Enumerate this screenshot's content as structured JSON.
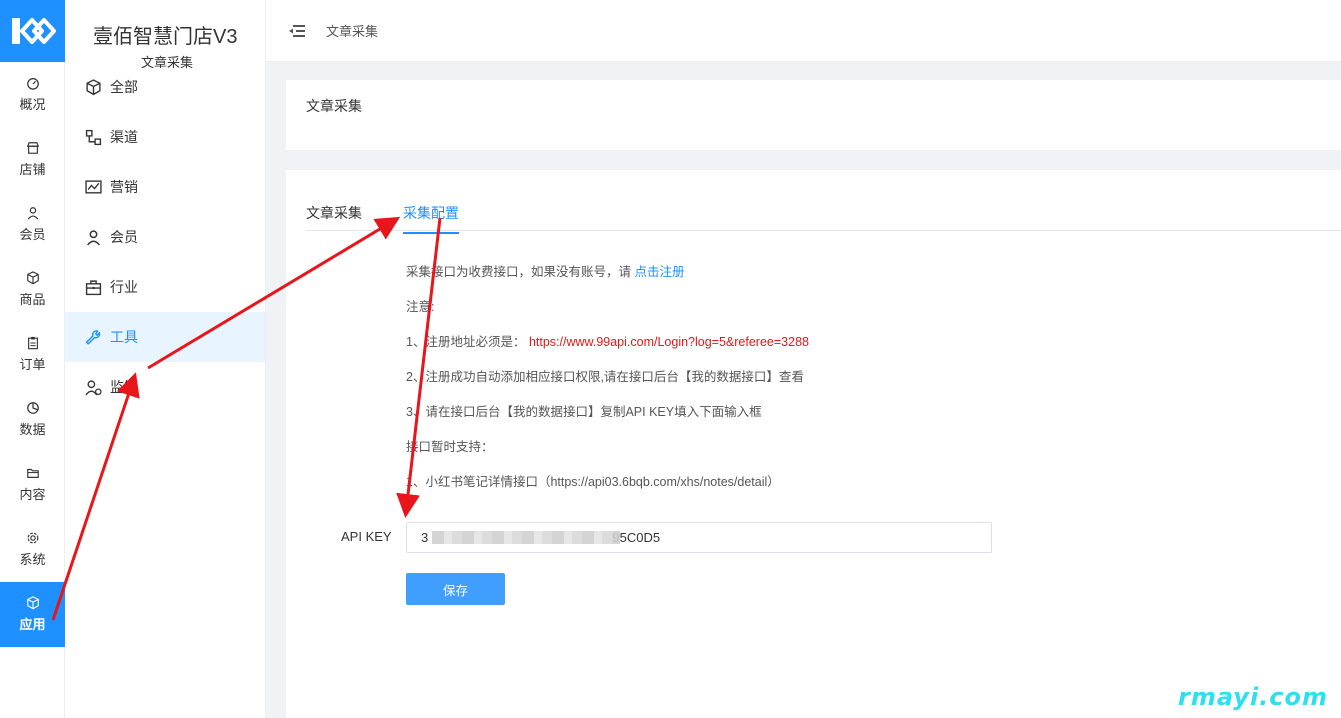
{
  "brand": {
    "title": "壹佰智慧门店V3",
    "subtitle": "文章采集"
  },
  "rail": [
    {
      "label": "概况",
      "icon": "dashboard-icon"
    },
    {
      "label": "店铺",
      "icon": "store-icon"
    },
    {
      "label": "会员",
      "icon": "user-icon"
    },
    {
      "label": "商品",
      "icon": "box-icon"
    },
    {
      "label": "订单",
      "icon": "clipboard-icon"
    },
    {
      "label": "数据",
      "icon": "pie-chart-icon"
    },
    {
      "label": "内容",
      "icon": "folder-icon"
    },
    {
      "label": "系统",
      "icon": "gear-icon"
    },
    {
      "label": "应用",
      "icon": "cube-icon",
      "active": true
    }
  ],
  "submenu": [
    {
      "label": "全部",
      "icon": "cube-icon"
    },
    {
      "label": "渠道",
      "icon": "channel-icon"
    },
    {
      "label": "营销",
      "icon": "trend-icon"
    },
    {
      "label": "会员",
      "icon": "user-icon"
    },
    {
      "label": "行业",
      "icon": "briefcase-icon"
    },
    {
      "label": "工具",
      "icon": "wrench-icon",
      "active": true
    },
    {
      "label": "监管",
      "icon": "users-icon"
    }
  ],
  "breadcrumb": "文章采集",
  "page_title": "文章采集",
  "tabs": [
    "文章采集",
    "采集配置"
  ],
  "notes": {
    "line1_text": "采集接口为收费接口，如果没有账号，请 ",
    "line1_link": "点击注册",
    "attention": "注意:",
    "line2_text": "1、注册地址必须是：  ",
    "line2_url": "https://www.99api.com/Login?log=5&referee=3288",
    "line3": "2、注册成功自动添加相应接口权限,请在接口后台【我的数据接口】查看",
    "line4": "3、请在接口后台【我的数据接口】复制API KEY填入下面输入框",
    "line5": "接口暂时支持：",
    "line6": "1、小红书笔记详情接口（https://api03.6bqb.com/xhs/notes/detail）"
  },
  "api_key": {
    "label": "API KEY",
    "value": "3                                                   95C0D5"
  },
  "save_label": "保存",
  "watermark": "rmayi.com",
  "colors": {
    "accent": "#1e90ff",
    "button": "#409eff",
    "annotation_red": "#e8151b",
    "watermark": "#2de0f0"
  }
}
